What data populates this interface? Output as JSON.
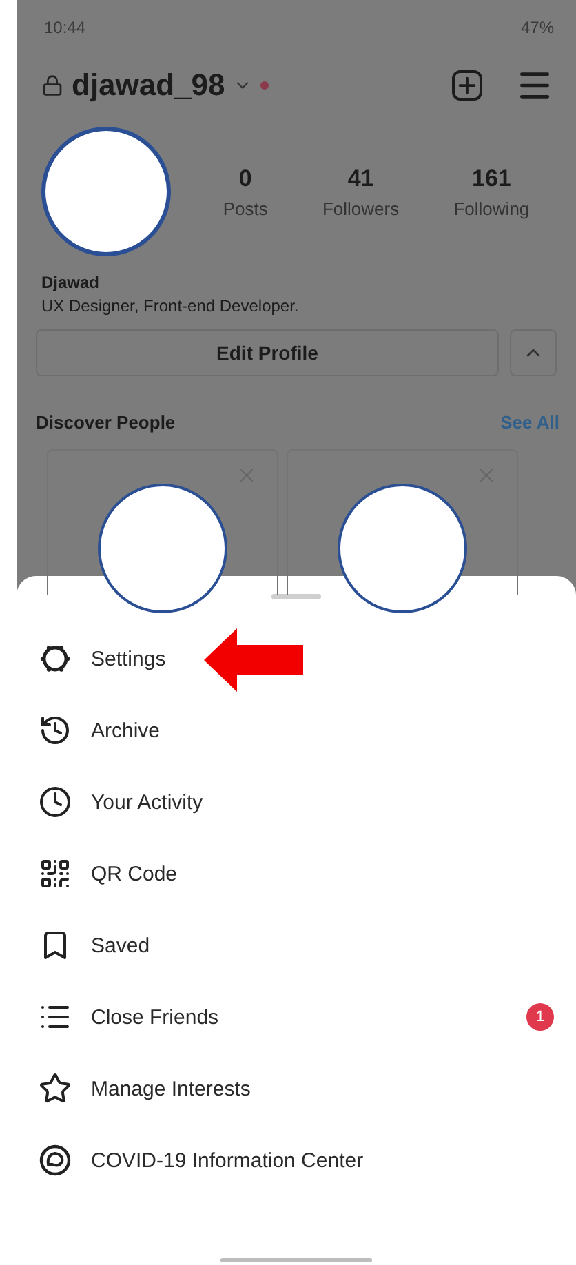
{
  "status_bar": {
    "time": "10:44",
    "battery": "47%"
  },
  "profile": {
    "username": "djawad_98",
    "notification_dot": true,
    "stats": [
      {
        "value": "0",
        "label": "Posts"
      },
      {
        "value": "41",
        "label": "Followers"
      },
      {
        "value": "161",
        "label": "Following"
      }
    ],
    "name": "Djawad",
    "bio": "UX Designer, Front-end Developer.",
    "edit_button": "Edit Profile"
  },
  "discover": {
    "title": "Discover People",
    "see_all": "See All",
    "cards": [
      {
        "kind": "person"
      },
      {
        "kind": "person"
      }
    ]
  },
  "menu": [
    {
      "label": "Settings",
      "highlighted": true
    },
    {
      "label": "Archive",
      "highlighted": false
    },
    {
      "label": "Your Activity",
      "highlighted": false
    },
    {
      "label": "QR Code",
      "highlighted": false
    },
    {
      "label": "Saved",
      "highlighted": false
    },
    {
      "label": "Close Friends",
      "highlighted": false,
      "badge": "1"
    },
    {
      "label": "Manage Interests",
      "highlighted": false
    },
    {
      "label": "COVID-19 Information Center",
      "highlighted": false
    }
  ]
}
